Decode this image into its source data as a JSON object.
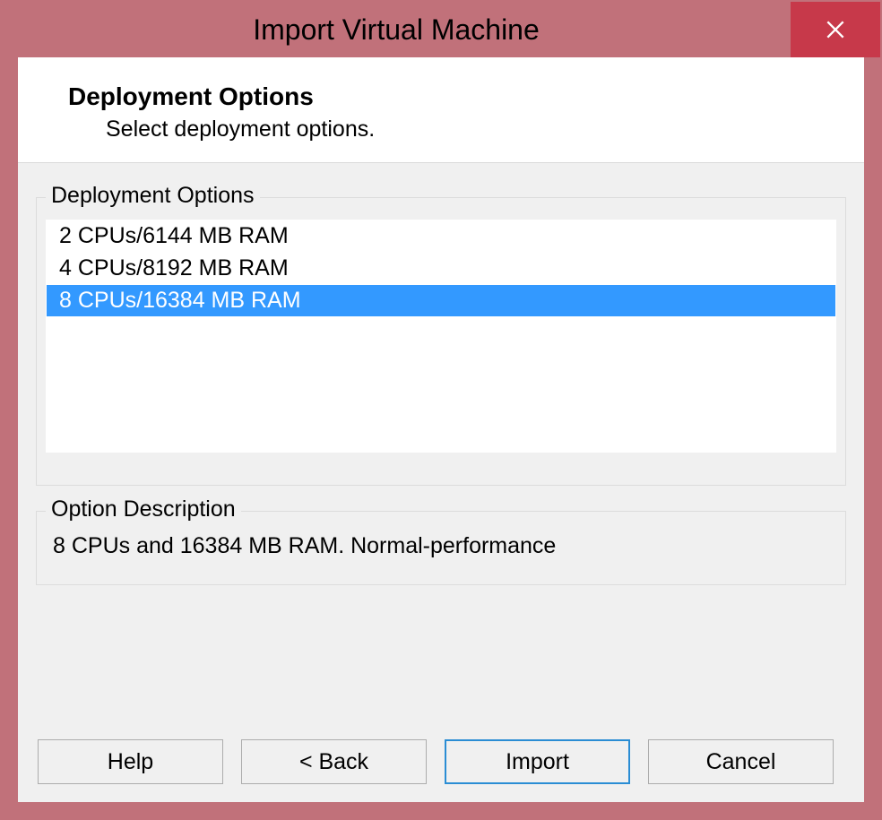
{
  "window": {
    "title": "Import Virtual Machine"
  },
  "header": {
    "title": "Deployment Options",
    "subtitle": "Select deployment options."
  },
  "options": {
    "legend": "Deployment Options",
    "items": [
      {
        "label": "2 CPUs/6144 MB RAM",
        "selected": false
      },
      {
        "label": "4 CPUs/8192 MB RAM",
        "selected": false
      },
      {
        "label": "8 CPUs/16384 MB RAM",
        "selected": true
      }
    ]
  },
  "description": {
    "legend": "Option Description",
    "text": "8 CPUs and 16384 MB RAM. Normal-performance"
  },
  "buttons": {
    "help": "Help",
    "back": "< Back",
    "import": "Import",
    "cancel": "Cancel"
  }
}
